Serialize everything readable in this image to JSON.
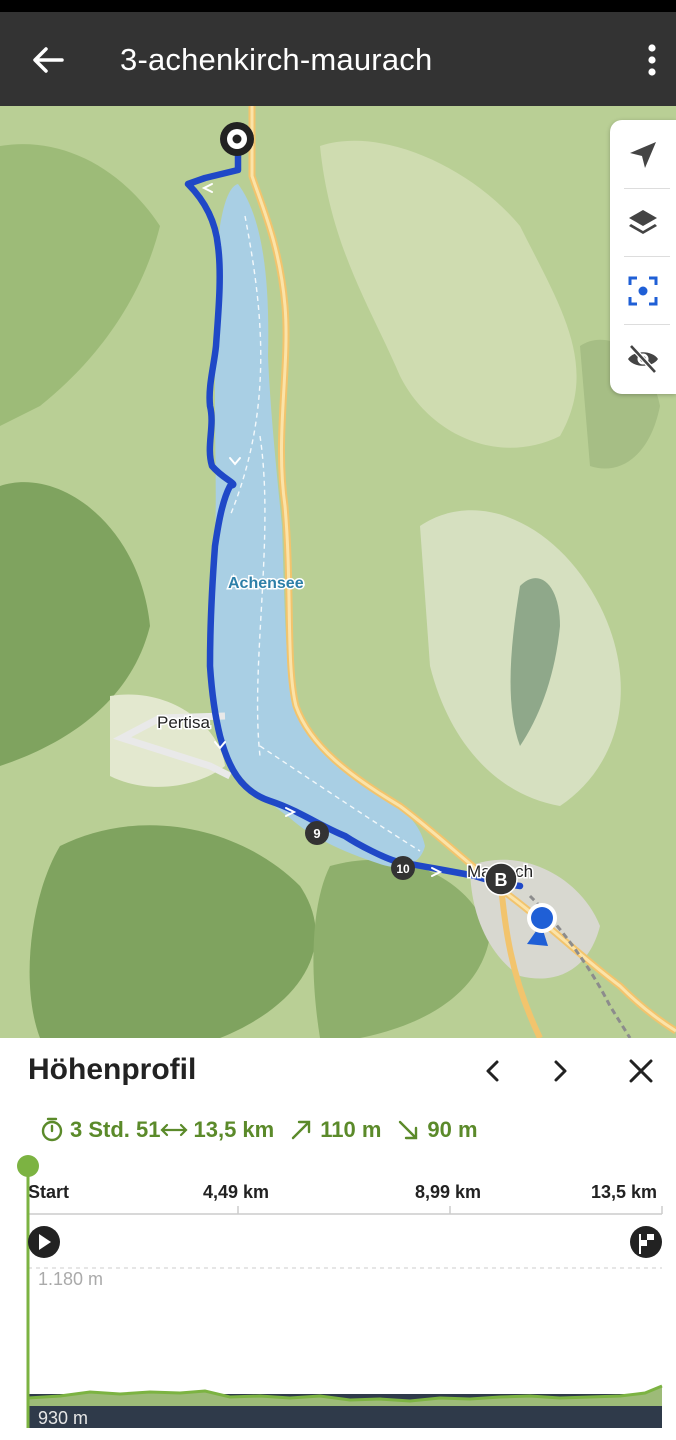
{
  "appbar": {
    "title": "3-achenkirch-maurach",
    "back_icon": "arrow-left-icon",
    "menu_icon": "more-vertical-icon"
  },
  "map": {
    "lake_label": "Achensee",
    "place_pertisau": "Pertisa",
    "place_maurach": "Maurach",
    "waypoint_9": "9",
    "waypoint_10": "10",
    "marker_b": "B",
    "colors": {
      "route": "#1f48c7",
      "lake": "#a9cfe4",
      "road": "#f2c46d",
      "land": "#b9cf95"
    },
    "controls": [
      {
        "icon": "navigation-arrow-icon"
      },
      {
        "icon": "layers-icon"
      },
      {
        "icon": "focus-center-icon"
      },
      {
        "icon": "eye-off-icon"
      }
    ]
  },
  "elevation": {
    "title": "Höhenprofil",
    "prev_icon": "chevron-left-icon",
    "next_icon": "chevron-right-icon",
    "close_icon": "close-icon",
    "stats": {
      "duration": "3 Std. 51",
      "distance": "13,5 km",
      "ascent": "110 m",
      "descent": "90 m"
    },
    "x_axis": [
      "Start",
      "4,49 km",
      "8,99 km",
      "13,5 km"
    ],
    "y_max_label": "1.180 m",
    "y_min_label": "930 m",
    "start_icon": "play-icon",
    "finish_icon": "finish-flag-icon",
    "accent_color": "#7cb342"
  }
}
